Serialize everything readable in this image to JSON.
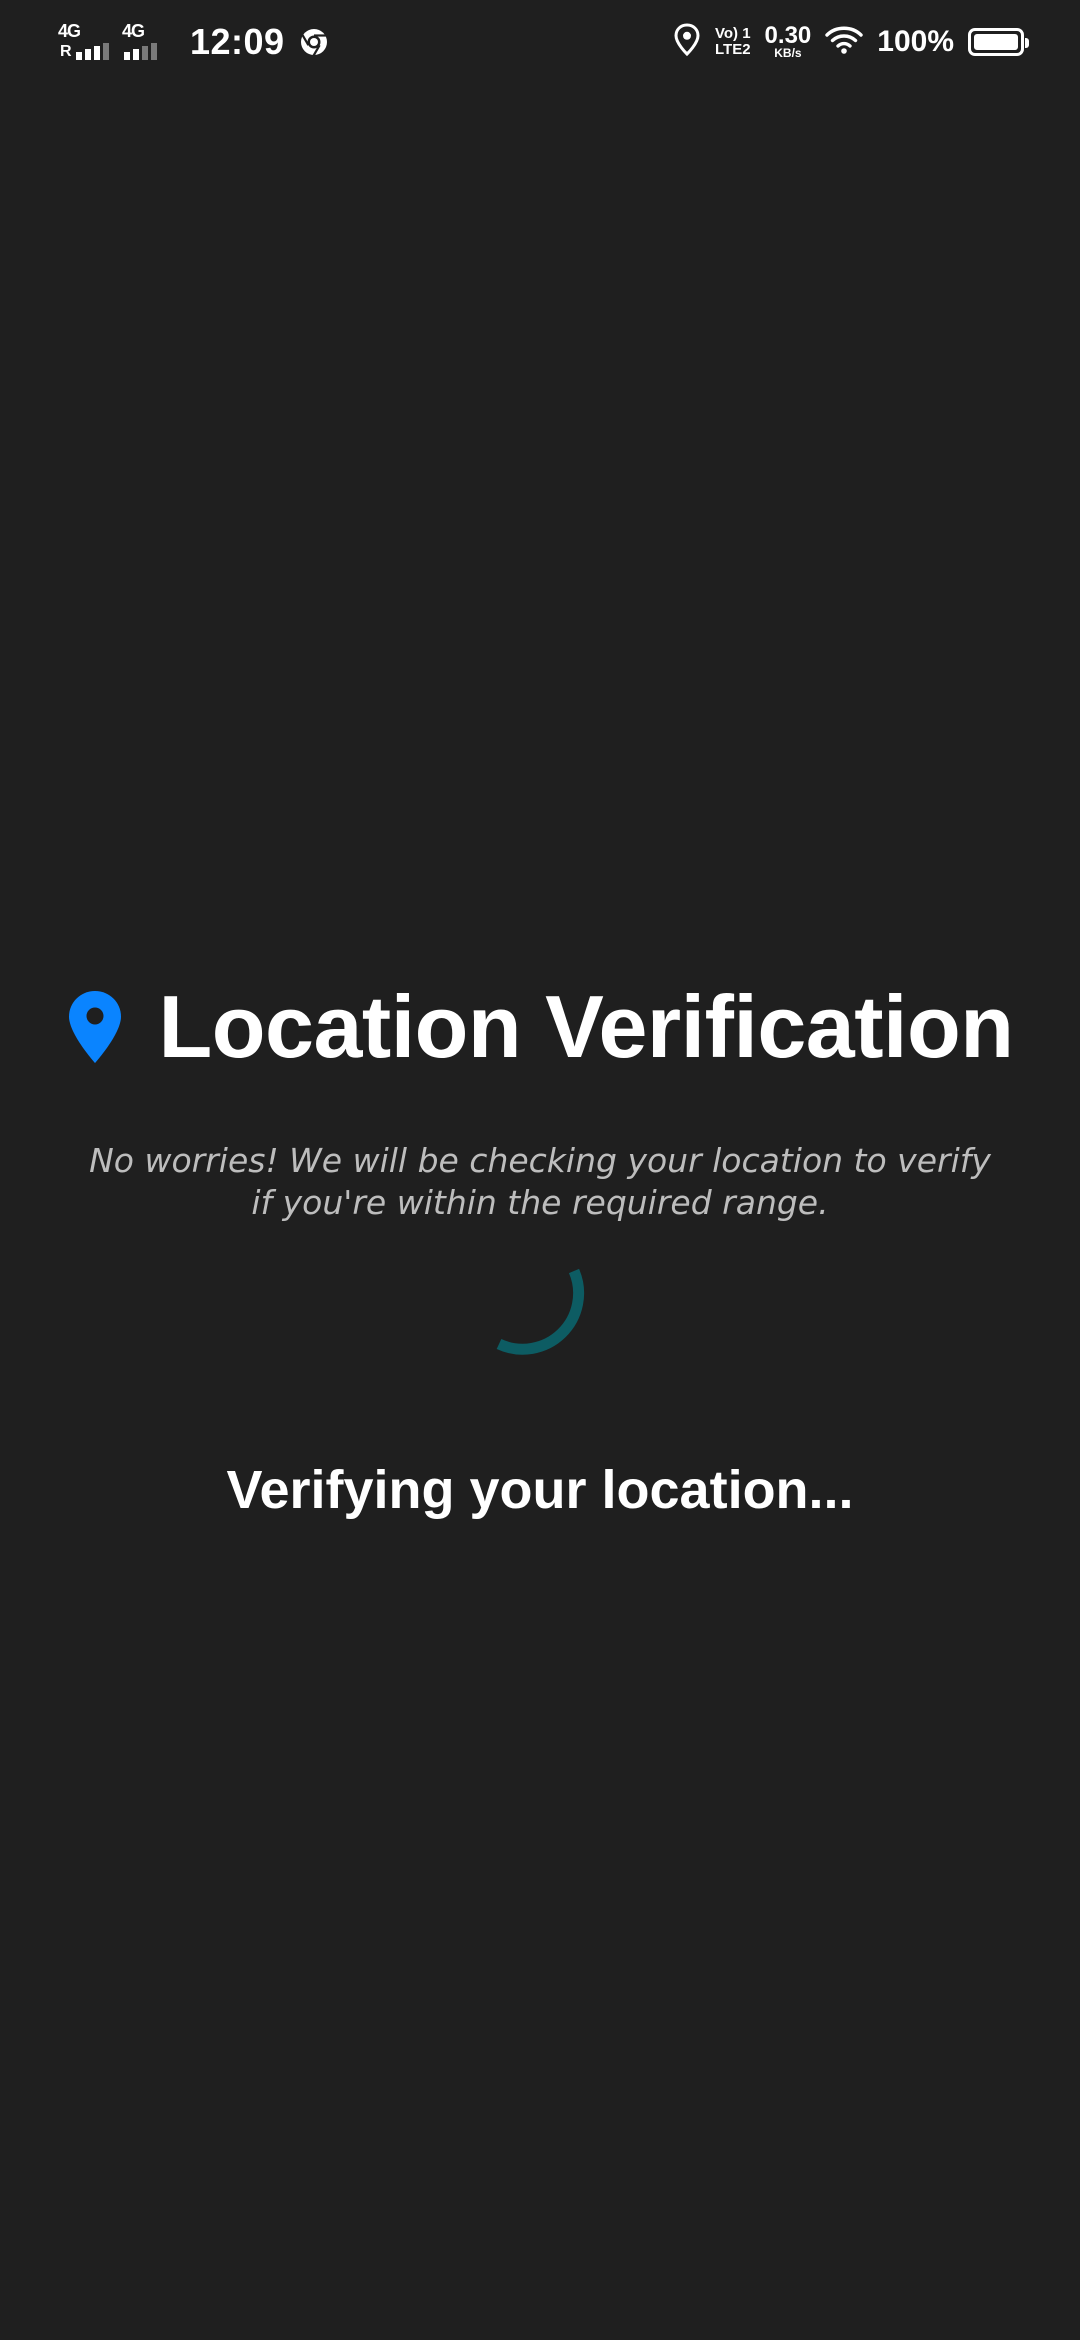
{
  "status_bar": {
    "sim1_label": "4G",
    "sim1_sub": "R",
    "sim2_label": "4G",
    "time": "12:09",
    "volte_line1": "Vo) 1",
    "volte_line2": "LTE2",
    "speed_value": "0.30",
    "speed_unit": "KB/s",
    "battery_percent": "100%",
    "battery_level": 1.0,
    "icons": [
      "chrome-icon",
      "location-icon",
      "wifi-icon",
      "battery-icon"
    ]
  },
  "main": {
    "title": "Location Verification",
    "subtitle": "No worries! We will be checking your location to verify if you're within the required range.",
    "status_text": "Verifying your location..."
  },
  "colors": {
    "background": "#1f1f1f",
    "pin_icon": "#0a84ff",
    "spinner": "#0d5c63",
    "subtitle_text": "#bdbdbd"
  }
}
